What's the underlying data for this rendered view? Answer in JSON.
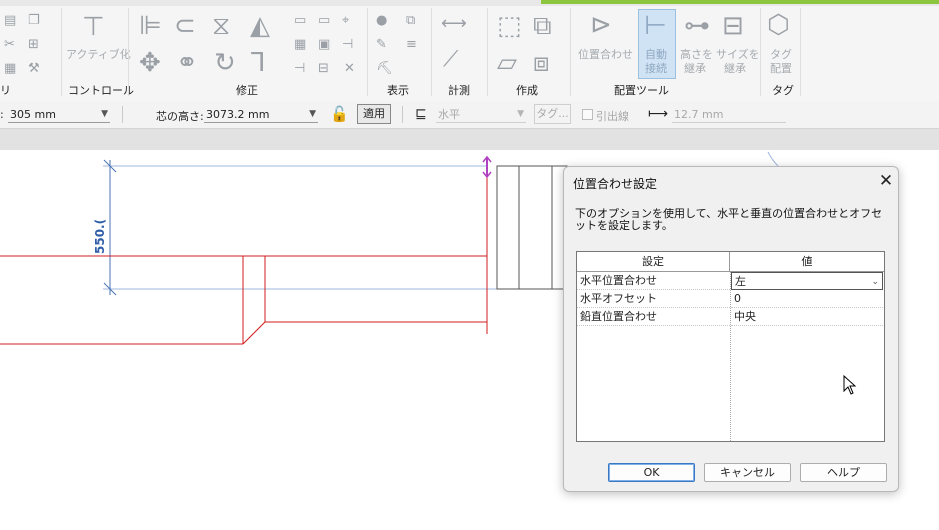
{
  "ribbon": {
    "panels": {
      "left_partial": "リ",
      "control": "コントロール",
      "modify": "修正",
      "display": "表示",
      "measure": "計測",
      "create": "作成",
      "placement_tools": "配置ツール",
      "tag": "タグ"
    },
    "buttons": {
      "activate": "アクティブ化",
      "align_position": "位置合わせ",
      "auto_connect": [
        "自動",
        "接続"
      ],
      "match_height": [
        "高さを",
        "継承"
      ],
      "match_size": [
        "サイズを",
        "継承"
      ],
      "tag_place": [
        "タグ",
        "配置"
      ]
    },
    "colors": {
      "accent_green": "#8cc63f",
      "selected_button": "#cfe3f4"
    }
  },
  "options_bar": {
    "width_value": "305 mm",
    "center_height_label": "芯の高さ:",
    "center_height_value": "3073.2 mm",
    "apply_label": "適用",
    "orientation_value": "水平",
    "tag_label": "タグ...",
    "leader_label": "引出線",
    "leader_length": "12.7 mm",
    "colon": ":"
  },
  "canvas": {
    "dimension_label": "550.(",
    "colors": {
      "dimension": "#4a73b5",
      "model_lines": "#d01c1c",
      "wall": "#555555",
      "marker": "#b040c0"
    }
  },
  "dialog": {
    "title": "位置合わせ設定",
    "description": "下のオプションを使用して、水平と垂直の位置合わせとオフセットを設定します。",
    "columns": [
      "設定",
      "値"
    ],
    "rows": [
      {
        "setting": "水平位置合わせ",
        "value": "左"
      },
      {
        "setting": "水平オフセット",
        "value": "0"
      },
      {
        "setting": "鉛直位置合わせ",
        "value": "中央"
      }
    ],
    "buttons": {
      "ok": "OK",
      "cancel": "キャンセル",
      "help": "ヘルプ"
    }
  }
}
